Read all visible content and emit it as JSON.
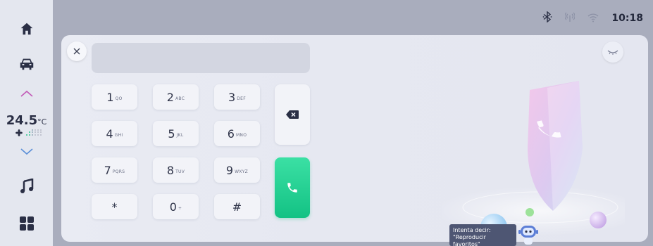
{
  "status": {
    "time": "10:18",
    "icons": [
      "bluetooth-icon",
      "cellular-signal-icon",
      "wifi-icon"
    ]
  },
  "sidebar": {
    "items": [
      {
        "name": "home",
        "icon": "home-icon"
      },
      {
        "name": "car",
        "icon": "car-icon"
      },
      {
        "name": "temp-up",
        "icon": "chevron-up-icon"
      },
      {
        "name": "temp-down",
        "icon": "chevron-down-icon"
      },
      {
        "name": "music",
        "icon": "music-icon"
      },
      {
        "name": "apps",
        "icon": "apps-grid-icon"
      }
    ],
    "temperature": {
      "value": "24.5",
      "unit": "°C"
    }
  },
  "dialer": {
    "number": "",
    "keys": [
      {
        "digit": "1",
        "letters": "QO"
      },
      {
        "digit": "2",
        "letters": "ABC"
      },
      {
        "digit": "3",
        "letters": "DEF"
      },
      {
        "digit": "4",
        "letters": "GHI"
      },
      {
        "digit": "5",
        "letters": "JKL"
      },
      {
        "digit": "6",
        "letters": "MNO"
      },
      {
        "digit": "7",
        "letters": "PQRS"
      },
      {
        "digit": "8",
        "letters": "TUV"
      },
      {
        "digit": "9",
        "letters": "WXYZ"
      },
      {
        "digit": "*",
        "letters": ""
      },
      {
        "digit": "0",
        "letters": "+"
      },
      {
        "digit": "#",
        "letters": ""
      }
    ]
  },
  "assistant": {
    "hint_line1": "Intenta decir:",
    "hint_line2": "\"Reproducir favoritos\""
  },
  "colors": {
    "accent_green": "#13c284",
    "background": "#a9adbd",
    "card": "#e8eaf2"
  }
}
